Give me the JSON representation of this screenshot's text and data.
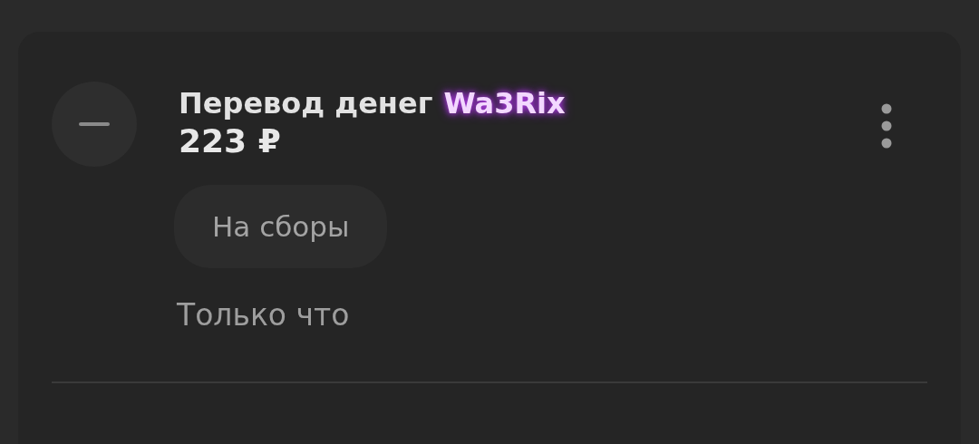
{
  "operation": {
    "title": "Перевод денег",
    "recipient": "Wa3Rix",
    "amount": "223 ₽",
    "tag": "На сборы",
    "time": "Только что"
  }
}
